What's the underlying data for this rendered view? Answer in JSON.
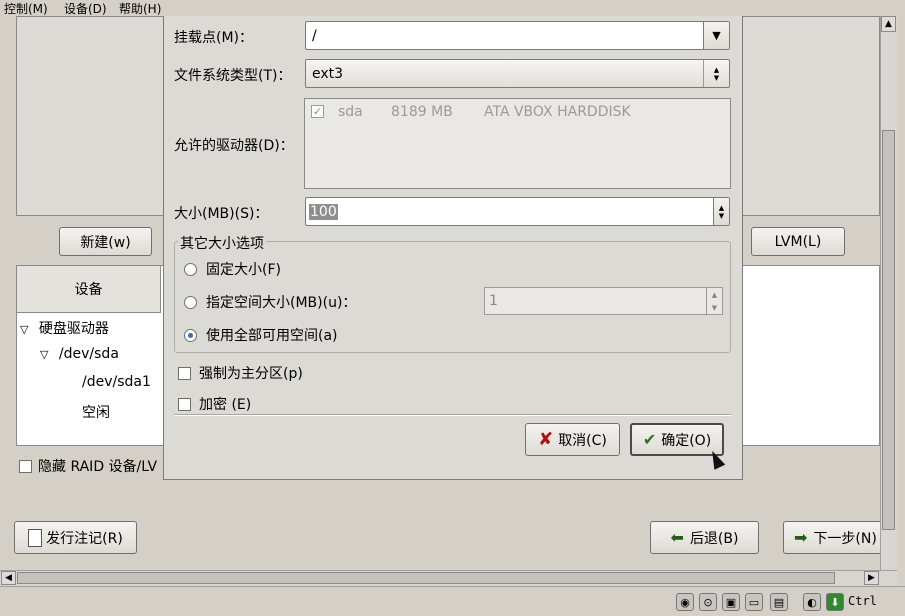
{
  "menubar": {
    "items": [
      "控制(M)",
      "设备(D)",
      "帮助(H)"
    ]
  },
  "background": {
    "new_button": "新建(w)",
    "lvm_button": "LVM(L)",
    "device_column": "设备",
    "tree": [
      "硬盘驱动器",
      "/dev/sda",
      "/dev/sda1",
      "空闲"
    ],
    "hide_raid_label": "隐藏 RAID 设备/LV",
    "release_notes_button": "发行注记(R)",
    "back_button": "后退(B)",
    "next_button": "下一步(N)"
  },
  "dialog": {
    "mount_label": "挂载点(M)：",
    "mount_value": "/",
    "fs_label": "文件系统类型(T)：",
    "fs_value": "ext3",
    "drives_label": "允许的驱动器(D)：",
    "drive": {
      "name": "sda",
      "size": "8189 MB",
      "model": "ATA VBOX HARDDISK"
    },
    "size_label": "大小(MB)(S)：",
    "size_value": "100",
    "other_size_title": "其它大小选项",
    "opt_fixed": "固定大小(F)",
    "opt_upto": "指定空间大小(MB)(u)：",
    "upto_value": "1",
    "opt_fill": "使用全部可用空间(a)",
    "force_primary": "强制为主分区(p)",
    "encrypt": "加密 (E)",
    "cancel_button": "取消(C)",
    "ok_button": "确定(O)"
  },
  "statusbar": {
    "host_key": "Ctrl"
  }
}
